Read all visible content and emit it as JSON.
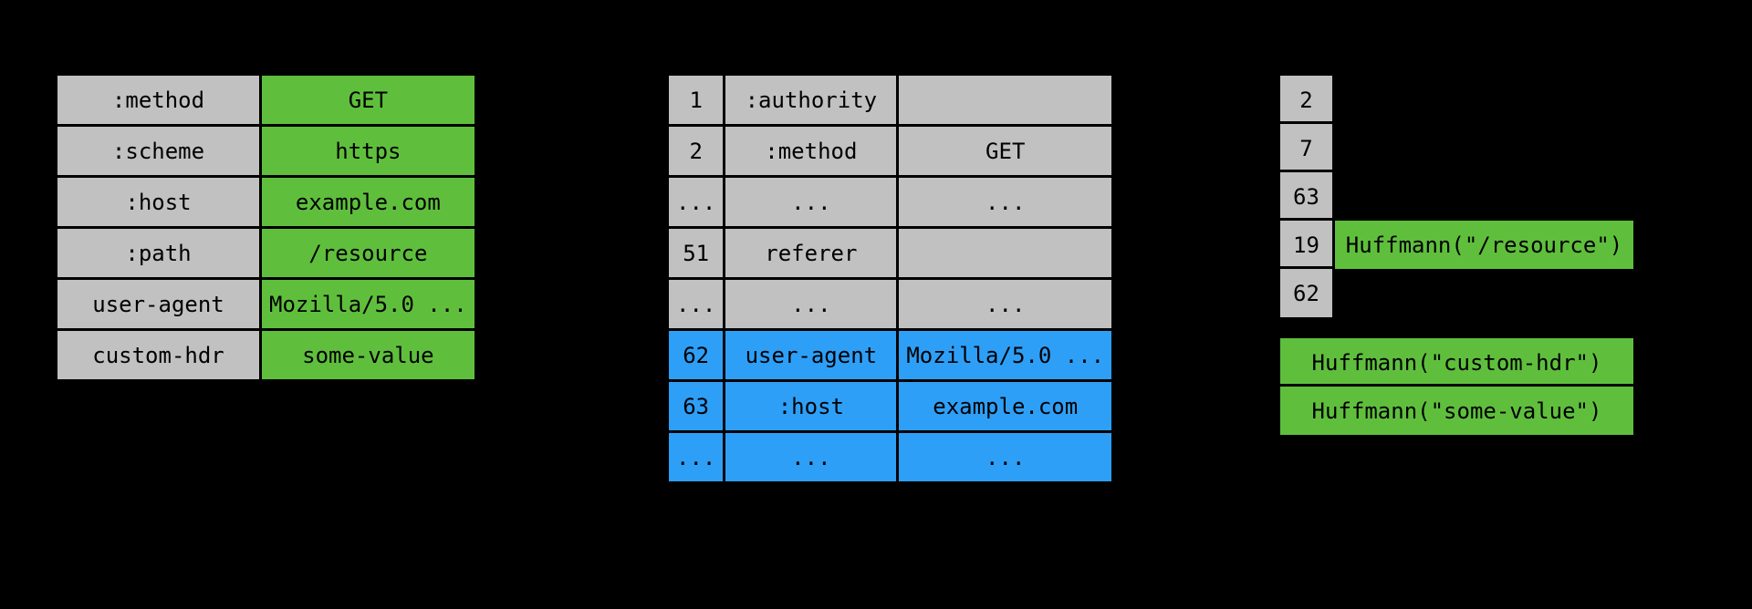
{
  "panel1": {
    "rows": [
      {
        "name": ":method",
        "value": "GET"
      },
      {
        "name": ":scheme",
        "value": "https"
      },
      {
        "name": ":host",
        "value": "example.com"
      },
      {
        "name": ":path",
        "value": "/resource"
      },
      {
        "name": "user-agent",
        "value": "Mozilla/5.0 ..."
      },
      {
        "name": "custom-hdr",
        "value": "some-value"
      }
    ]
  },
  "panel2": {
    "static_rows": [
      {
        "idx": "1",
        "name": ":authority",
        "value": ""
      },
      {
        "idx": "2",
        "name": ":method",
        "value": "GET"
      },
      {
        "idx": "...",
        "name": "...",
        "value": "..."
      },
      {
        "idx": "51",
        "name": "referer",
        "value": ""
      },
      {
        "idx": "...",
        "name": "...",
        "value": "..."
      }
    ],
    "dynamic_rows": [
      {
        "idx": "62",
        "name": "user-agent",
        "value": "Mozilla/5.0 ..."
      },
      {
        "idx": "63",
        "name": ":host",
        "value": "example.com"
      },
      {
        "idx": "...",
        "name": "...",
        "value": "..."
      }
    ]
  },
  "panel3": {
    "rows": [
      {
        "idx": "2",
        "value": null
      },
      {
        "idx": "7",
        "value": null
      },
      {
        "idx": "63",
        "value": null
      },
      {
        "idx": "19",
        "value": "Huffmann(\"/resource\")"
      },
      {
        "idx": "62",
        "value": null
      }
    ],
    "tail": [
      "Huffmann(\"custom-hdr\")",
      "Huffmann(\"some-value\")"
    ]
  }
}
